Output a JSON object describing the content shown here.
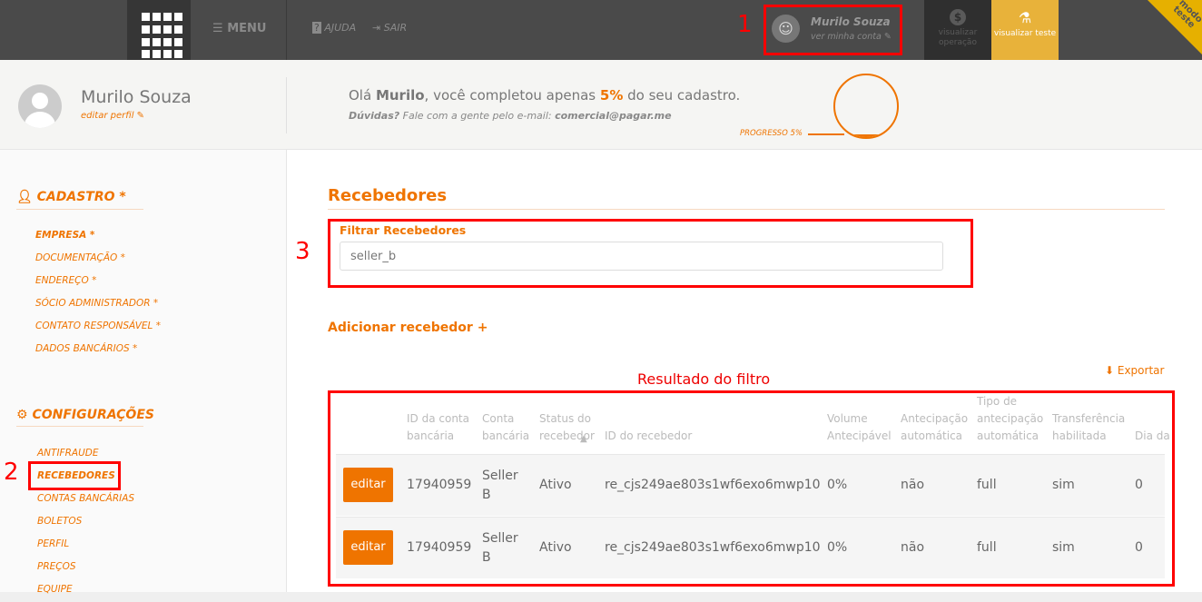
{
  "topbar": {
    "menu": "MENU",
    "help": "AJUDA",
    "logout": "SAIR",
    "user_name": "Murilo Souza",
    "user_link": "ver minha conta",
    "btn_operation": "visualizar operação",
    "btn_test": "visualizar teste",
    "corner_badge": "modo teste"
  },
  "header": {
    "name": "Murilo Souza",
    "edit_profile": "editar perfil",
    "greeting_pre": "Olá ",
    "greeting_name": "Murilo",
    "greeting_mid": ", você completou apenas ",
    "greeting_pct": "5%",
    "greeting_post": " do seu cadastro.",
    "help_q": "Dúvidas?",
    "help_text": " Fale com a gente pelo e-mail: ",
    "help_email": "comercial@pagar.me",
    "progress_label": "PROGRESSO 5%",
    "progress_value": 5
  },
  "sidebar": {
    "section1": "CADASTRO *",
    "items1": [
      "EMPRESA *",
      "DOCUMENTAÇÃO *",
      "ENDEREÇO *",
      "SÓCIO ADMINISTRADOR *",
      "CONTATO RESPONSÁVEL *",
      "DADOS BANCÁRIOS *"
    ],
    "section2": "CONFIGURAÇÕES",
    "items2": [
      "ANTIFRAUDE",
      "RECEBEDORES",
      "CONTAS BANCÁRIAS",
      "BOLETOS",
      "PERFIL",
      "PREÇOS",
      "EQUIPE"
    ]
  },
  "main": {
    "title": "Recebedores",
    "filter_label": "Filtrar Recebedores",
    "filter_value": "seller_b",
    "add": "Adicionar recebedor +",
    "export": "Exportar",
    "result_label": "Resultado do filtro",
    "columns": [
      "",
      "ID da conta bancária",
      "Conta bancária",
      "Status do recebedor",
      "ID do recebedor",
      "Volume Antecipável",
      "Antecipação automática",
      "Tipo de antecipação automática",
      "Transferência habilitada",
      "Dia da transf"
    ],
    "edit": "editar",
    "rows": [
      [
        "17940959",
        "Seller B",
        "Ativo",
        "re_cjs249ae803s1wf6exo6mwp10",
        "0%",
        "não",
        "full",
        "sim",
        "0"
      ],
      [
        "17940959",
        "Seller B",
        "Ativo",
        "re_cjs249ae803s1wf6exo6mwp10",
        "0%",
        "não",
        "full",
        "sim",
        "0"
      ]
    ]
  },
  "annotations": [
    "1",
    "2",
    "3"
  ],
  "colors": {
    "accent": "#ef7400",
    "topbar": "#4a4a4a",
    "test": "#e8b23a",
    "highlight": "#ff0000"
  }
}
